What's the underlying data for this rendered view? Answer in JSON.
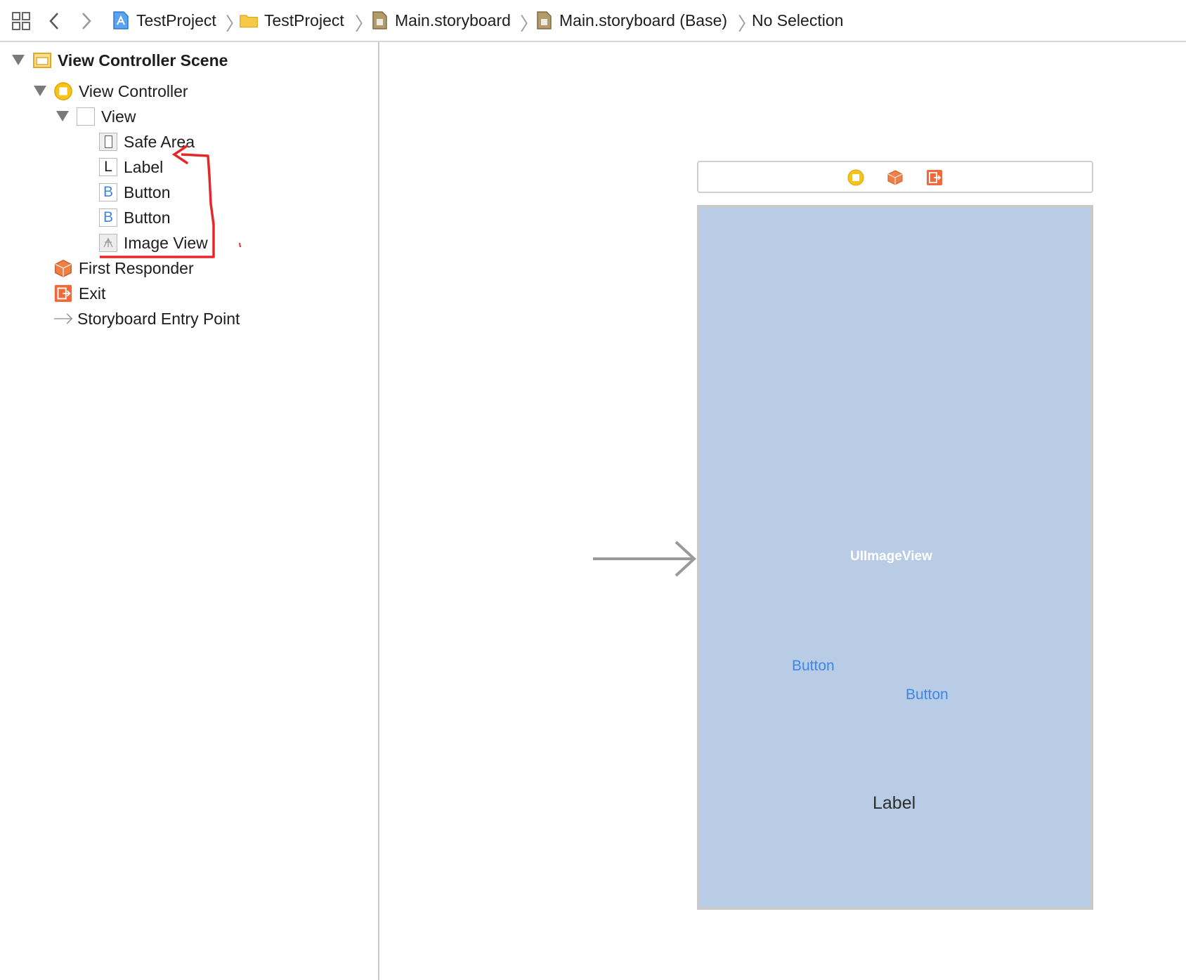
{
  "jumpbar": {
    "crumbs": [
      {
        "label": "TestProject",
        "icon": "project-icon"
      },
      {
        "label": "TestProject",
        "icon": "folder-icon"
      },
      {
        "label": "Main.storyboard",
        "icon": "storyboard-icon"
      },
      {
        "label": "Main.storyboard (Base)",
        "icon": "storyboard-icon"
      },
      {
        "label": "No Selection"
      }
    ]
  },
  "outline": {
    "scene": "View Controller Scene",
    "view_controller": "View Controller",
    "view": "View",
    "safe_area": "Safe Area",
    "label": "Label",
    "label_glyph": "L",
    "button1": "Button",
    "button2": "Button",
    "button_glyph": "B",
    "image_view": "Image View",
    "first_responder": "First Responder",
    "exit": "Exit",
    "entry_point": "Storyboard Entry Point"
  },
  "canvas": {
    "image_view_text": "UIImageView",
    "button1": "Button",
    "button2": "Button",
    "label": "Label"
  },
  "colors": {
    "scene_background": "#b8cde5",
    "button_text": "#3d86e6",
    "annotation": "#e5262b",
    "view_controller_icon": "#f6c21c",
    "first_responder_icon": "#ef7f45"
  }
}
